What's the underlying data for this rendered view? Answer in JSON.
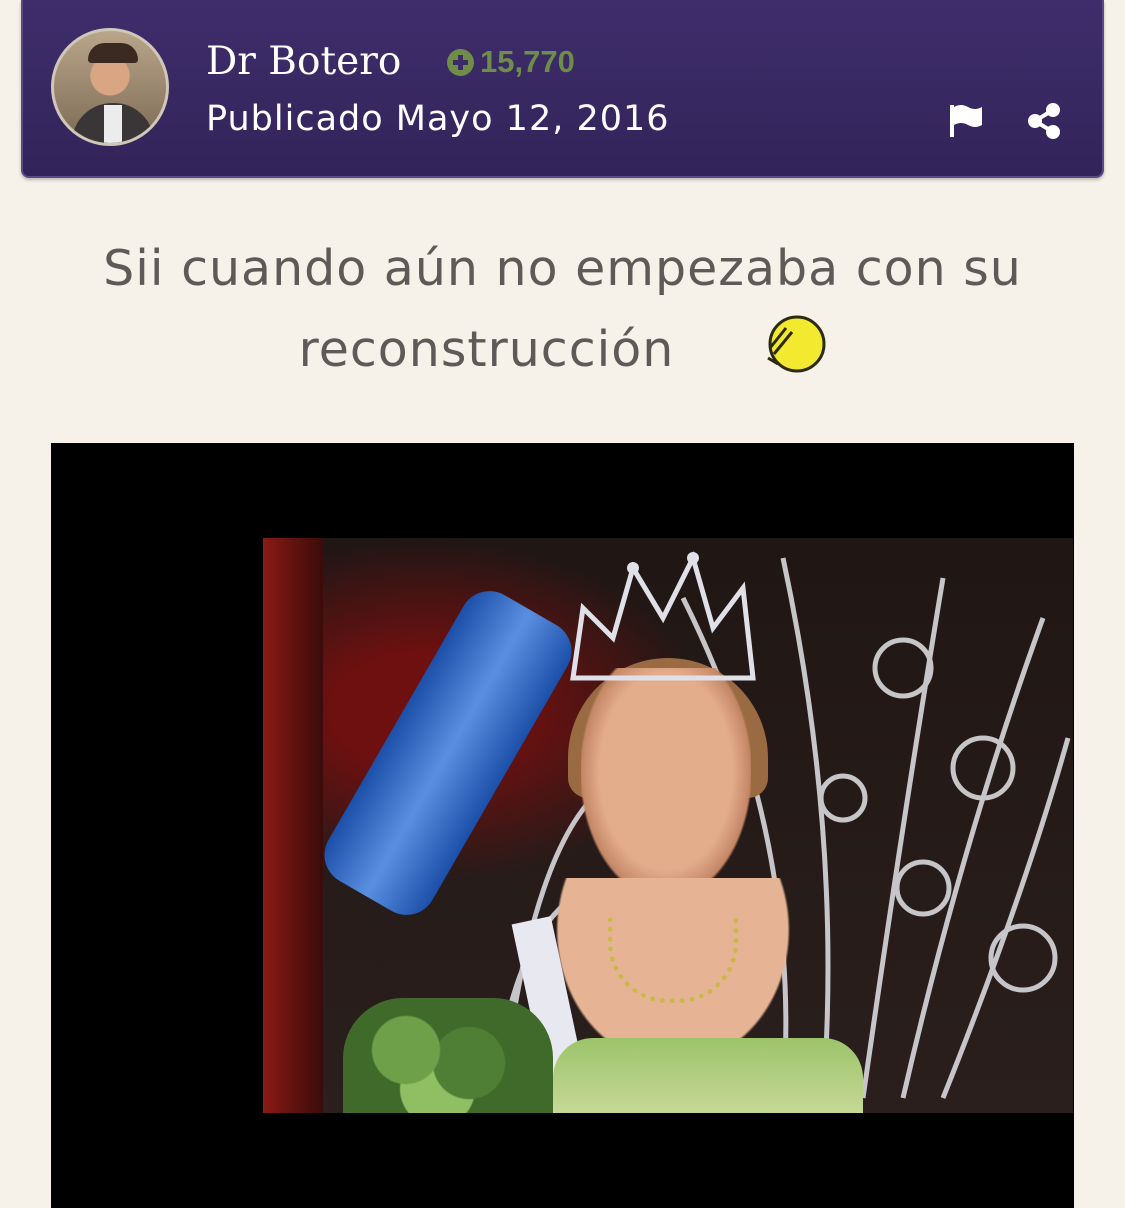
{
  "post": {
    "author": "Dr Botero",
    "reputation": "15,770",
    "published": "Publicado Mayo 12, 2016",
    "text": "Sii cuando aún no empezaba con su reconstrucción"
  },
  "icons": {
    "reputation": "plus-circle-icon",
    "report": "flag-icon",
    "share": "share-icon",
    "emoji": "emoji-icon"
  },
  "colors": {
    "header_bg": "#3a2a66",
    "reputation": "#6f8c4a",
    "page_bg": "#f6f2ea",
    "text": "#5f5a57"
  }
}
